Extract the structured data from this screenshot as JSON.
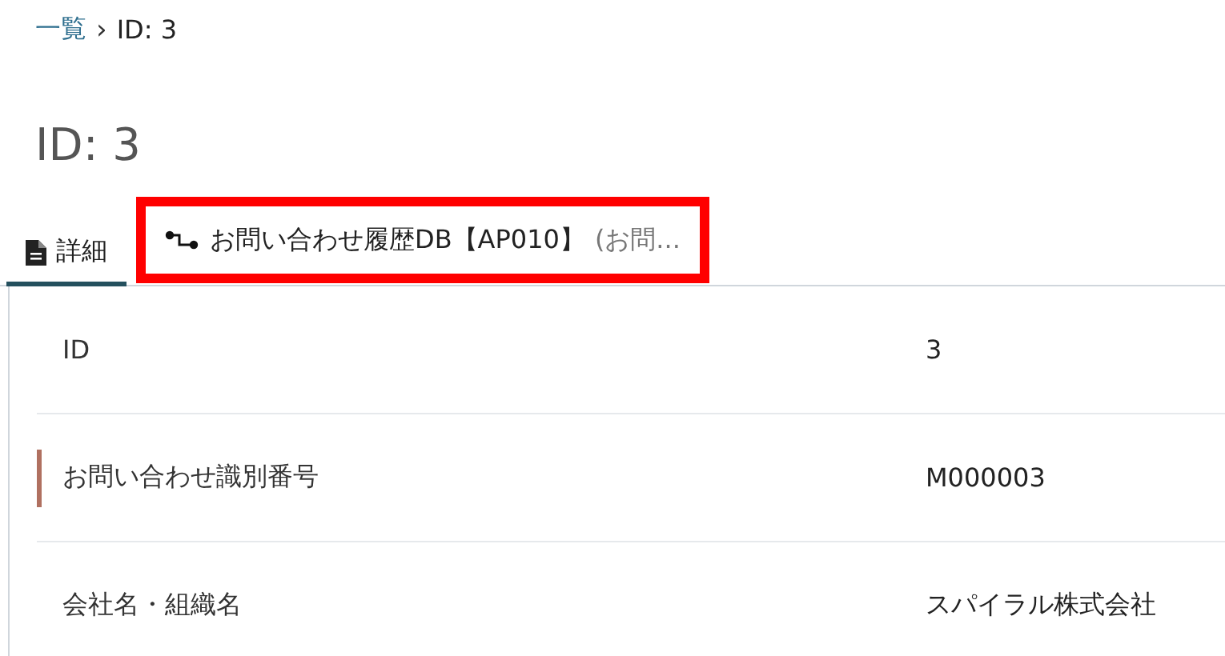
{
  "breadcrumb": {
    "link": "一覧",
    "separator": "›",
    "current": "ID: 3"
  },
  "title": "ID: 3",
  "tabs": [
    {
      "kind": "document",
      "label": "詳細",
      "selected": true,
      "highlighted": false
    },
    {
      "kind": "relation",
      "label": "お問い合わせ履歴DB【AP010】",
      "suffix": "(お問...",
      "selected": false,
      "highlighted": true
    }
  ],
  "fields": [
    {
      "label": "ID",
      "value": "3",
      "marked": false
    },
    {
      "label": "お問い合わせ識別番号",
      "value": "M000003",
      "marked": true
    },
    {
      "label": "会社名・組織名",
      "value": "スパイラル株式会社",
      "marked": false
    }
  ]
}
